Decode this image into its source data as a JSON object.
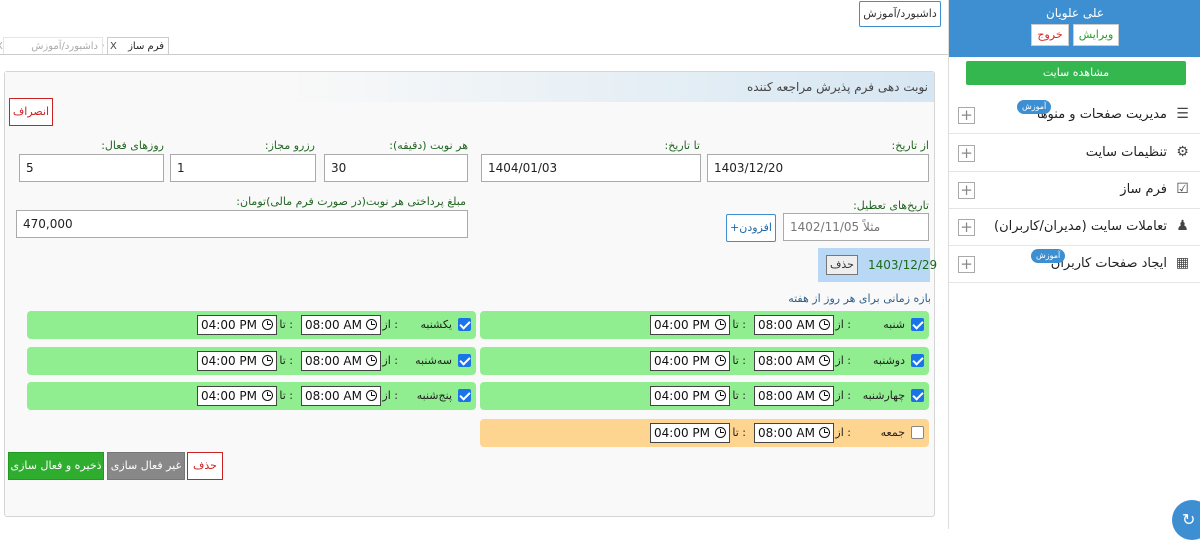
{
  "sidebar": {
    "user_name": "علی علویان",
    "edit_label": "ویرایش",
    "logout_label": "خروج",
    "view_site_label": "مشاهده سایت",
    "menu": [
      {
        "label": "مدیریت صفحات و منوها",
        "icon": "list-icon",
        "badge": "آموزش"
      },
      {
        "label": "تنظیمات سایت",
        "icon": "gear-icon",
        "badge": ""
      },
      {
        "label": "فرم ساز",
        "icon": "checkbox-icon",
        "badge": ""
      },
      {
        "label": "تعاملات سایت (مدیران/کاربران)",
        "icon": "users-icon",
        "badge": ""
      },
      {
        "label": "ایجاد صفحات کاربران",
        "icon": "pages-icon",
        "badge": "آموزش"
      }
    ]
  },
  "topbar": {
    "dashboard_button": "داشبورد/آموزش"
  },
  "tabs": [
    {
      "label": "فرم ساز",
      "active": true
    },
    {
      "label": "داشبورد/آموزش",
      "active": false
    }
  ],
  "panel": {
    "title": "نوبت دهی فرم پذیرش مراجعه کننده",
    "cancel_label": "انصراف",
    "from_date_label": "از تاریخ:",
    "from_date_value": "1403/12/20",
    "to_date_label": "تا تاریخ:",
    "to_date_value": "1404/01/03",
    "duration_label": "هر نوبت (دقیقه):",
    "duration_value": "30",
    "reserve_label": "رزرو مجاز:",
    "reserve_value": "1",
    "active_days_label": "روزهای فعال:",
    "active_days_value": "5",
    "holidays_label": "تاریخ‌های تعطیل:",
    "holiday_placeholder": "مثلاً 1402/11/05",
    "add_label": "+افزودن",
    "holiday_date": "1403/12/29",
    "holiday_delete": "حذف",
    "price_label": "مبلغ پرداختی هر نوبت(در صورت فرم مالی)تومان:",
    "price_value": "470,000",
    "week_title": "بازه زمانی برای هر روز از هفته",
    "from_label": "از :",
    "to_label": "تا :",
    "days": [
      {
        "name": "شنبه",
        "checked": true,
        "from": "08:00 AM",
        "to": "04:00 PM"
      },
      {
        "name": "یکشنبه",
        "checked": true,
        "from": "08:00 AM",
        "to": "04:00 PM"
      },
      {
        "name": "دوشنبه",
        "checked": true,
        "from": "08:00 AM",
        "to": "04:00 PM"
      },
      {
        "name": "سه‌شنبه",
        "checked": true,
        "from": "08:00 AM",
        "to": "04:00 PM"
      },
      {
        "name": "چهارشنبه",
        "checked": true,
        "from": "08:00 AM",
        "to": "04:00 PM"
      },
      {
        "name": "پنج‌شنبه",
        "checked": true,
        "from": "08:00 AM",
        "to": "04:00 PM"
      },
      {
        "name": "جمعه",
        "checked": false,
        "from": "08:00 AM",
        "to": "04:00 PM"
      }
    ],
    "save_label": "ذخیره و فعال سازی",
    "deactivate_label": "غیر فعال سازی",
    "delete_label": "حذف"
  },
  "colors": {
    "accent": "#3d8fd1",
    "active_row": "#90ee90",
    "inactive_row": "#fdd591",
    "save": "#2fad2f"
  }
}
